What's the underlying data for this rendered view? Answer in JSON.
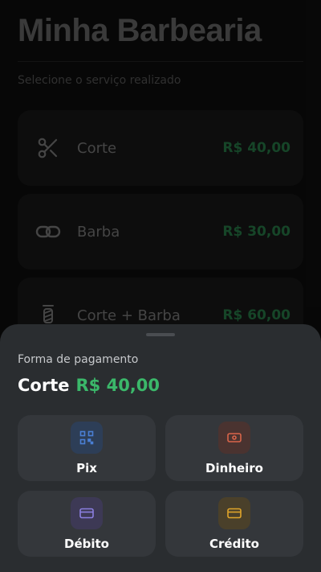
{
  "header": {
    "title": "Minha Barbearia",
    "subtitle": "Selecione o serviço realizado"
  },
  "services": [
    {
      "name": "Corte",
      "price": "R$ 40,00",
      "icon": "scissors-icon"
    },
    {
      "name": "Barba",
      "price": "R$ 30,00",
      "icon": "link-icon"
    },
    {
      "name": "Corte + Barba",
      "price": "R$ 60,00",
      "icon": "barber-pole-icon"
    }
  ],
  "sheet": {
    "label": "Forma de pagamento",
    "service": "Corte",
    "price": "R$ 40,00",
    "methods": [
      {
        "label": "Pix",
        "icon": "qrcode-icon",
        "color": "#4a7fd4"
      },
      {
        "label": "Dinheiro",
        "icon": "cash-icon",
        "color": "#d9654a"
      },
      {
        "label": "Débito",
        "icon": "card-icon",
        "color": "#8b7fe0"
      },
      {
        "label": "Crédito",
        "icon": "card-icon",
        "color": "#e0a52a"
      }
    ]
  }
}
